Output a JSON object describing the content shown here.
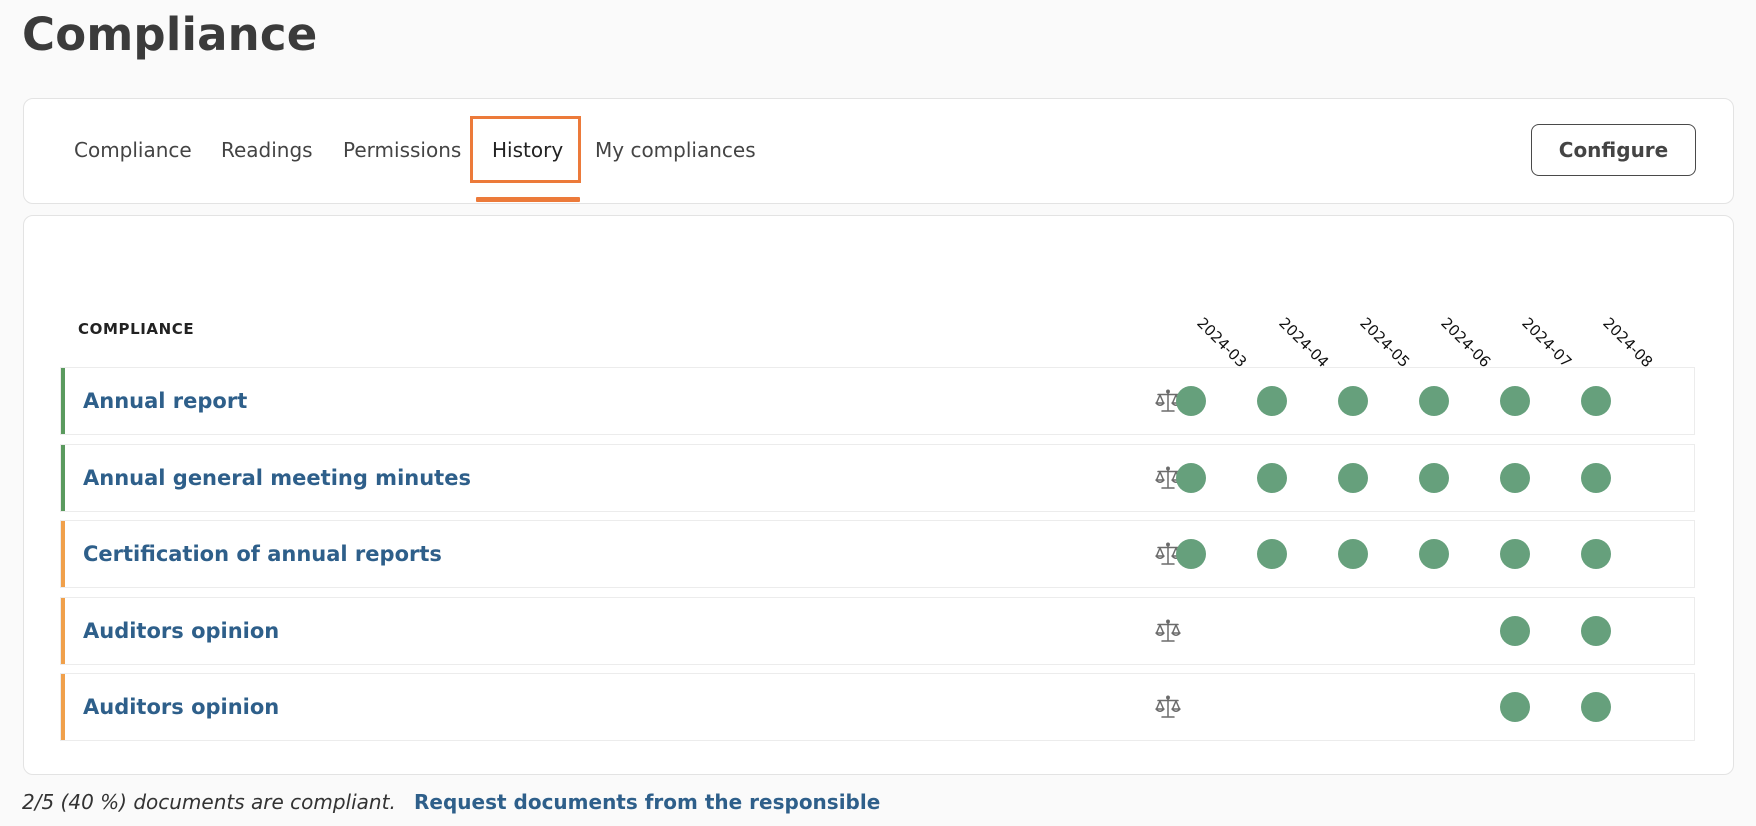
{
  "page": {
    "title": "Compliance"
  },
  "tabs": {
    "items": [
      {
        "label": "Compliance",
        "active": false
      },
      {
        "label": "Readings",
        "active": false
      },
      {
        "label": "Permissions",
        "active": false
      },
      {
        "label": "History",
        "active": true
      },
      {
        "label": "My compliances",
        "active": false
      }
    ],
    "configure_label": "Configure"
  },
  "table": {
    "column_header": "COMPLIANCE",
    "months": [
      "2024-03",
      "2024-04",
      "2024-05",
      "2024-06",
      "2024-07",
      "2024-08"
    ],
    "rows": [
      {
        "name": "Annual report",
        "status_color": "#5a9a5e",
        "compliant": [
          true,
          true,
          true,
          true,
          true,
          true
        ]
      },
      {
        "name": "Annual general meeting minutes",
        "status_color": "#5a9a5e",
        "compliant": [
          true,
          true,
          true,
          true,
          true,
          true
        ]
      },
      {
        "name": "Certification of annual reports",
        "status_color": "#f0a04b",
        "compliant": [
          true,
          true,
          true,
          true,
          true,
          true
        ]
      },
      {
        "name": "Auditors opinion",
        "status_color": "#f0a04b",
        "compliant": [
          false,
          false,
          false,
          false,
          true,
          true
        ]
      },
      {
        "name": "Auditors opinion",
        "status_color": "#f0a04b",
        "compliant": [
          false,
          false,
          false,
          false,
          true,
          true
        ]
      }
    ]
  },
  "footer": {
    "summary": "2/5 (40 %) documents are compliant.",
    "link": "Request documents from the responsible"
  },
  "colors": {
    "accent": "#ec7a3a",
    "link": "#2e5f8a",
    "dot": "#66a07c"
  },
  "icons": {
    "row_icon": "balance-scale-icon"
  }
}
